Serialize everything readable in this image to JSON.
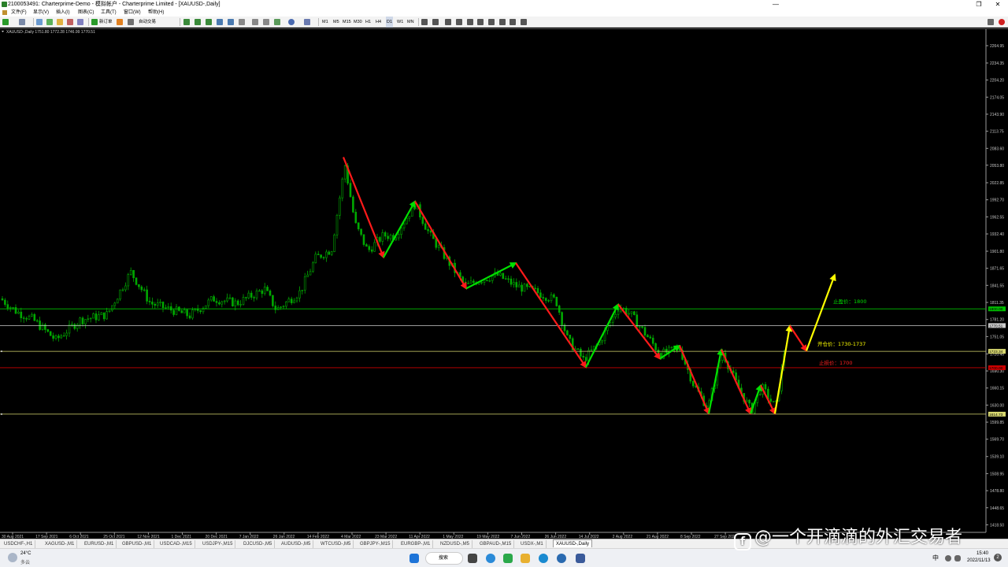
{
  "window": {
    "title": "2100053491: Charterprime-Demo - 模拟帐户 - Charterprime Limited - [XAUUSD-,Daily]",
    "controls": {
      "minimize": "—",
      "restore": "❐",
      "close": "✕"
    }
  },
  "menu": [
    "文件(F)",
    "显示(V)",
    "插入(I)",
    "图表(C)",
    "工具(T)",
    "窗口(W)",
    "帮助(H)"
  ],
  "toolbar": {
    "new_order": "新订单",
    "auto_trading": "自动交易",
    "timeframes": [
      "M1",
      "M5",
      "M15",
      "M30",
      "H1",
      "H4",
      "D1",
      "W1",
      "MN"
    ]
  },
  "chart": {
    "info": "XAUUSD-,Daily  1751.80 1772.28 1746.99 1770.51",
    "price_ticks": [
      "2264.95",
      "2234.35",
      "2204.20",
      "2174.05",
      "2143.90",
      "2113.75",
      "2083.60",
      "2053.80",
      "2022.85",
      "1992.70",
      "1962.55",
      "1932.40",
      "1901.80",
      "1871.65",
      "1841.55",
      "1811.35",
      "1781.20",
      "1751.05",
      "1720.45",
      "1690.30",
      "1660.15",
      "1630.00",
      "1599.85",
      "1569.70",
      "1539.10",
      "1508.95",
      "1478.80",
      "1448.65",
      "1418.50"
    ],
    "date_ticks": [
      "30 Aug 2021",
      "17 Sep 2021",
      "6 Oct 2021",
      "25 Oct 2021",
      "12 Nov 2021",
      "1 Dec 2021",
      "20 Dec 2021",
      "7 Jan 2022",
      "26 Jan 2022",
      "14 Feb 2022",
      "4 Mar 2022",
      "23 Mar 2022",
      "11 Apr 2022",
      "1 May 2022",
      "19 May 2022",
      "7 Jun 2022",
      "26 Jun 2022",
      "14 Jul 2022",
      "2 Aug 2022",
      "21 Aug 2022",
      "8 Sep 2022",
      "27 Sep 2022"
    ],
    "h_lines": [
      {
        "price": 1800,
        "color": "#00c000",
        "tag": "1800.00"
      },
      {
        "price": 1770.51,
        "color": "#cccccc",
        "tag": "1770.51"
      },
      {
        "price": 1725,
        "color": "#d8d870",
        "tag": "1723.34"
      },
      {
        "price": 1696,
        "color": "#cc0000",
        "tag": "1700.00"
      },
      {
        "price": 1614,
        "color": "#d8d870",
        "tag": "1614.73"
      }
    ],
    "annotations": {
      "take_profit": "止盈价：1800",
      "open_price": "开仓价：1730-1737",
      "stop_loss": "止损价：1700"
    },
    "colors": {
      "up": "#00e000",
      "down": "#ff1a1a",
      "projection": "#ffff00",
      "candle": "#00a800"
    }
  },
  "tabs": [
    "USDCHF-,H1",
    "XAGUSD-,M1",
    "EURUSD-,M1",
    "GBPUSD-,M1",
    "USDCAD-,M15",
    "USDJPY-,M15",
    "DJCUSD-,M5",
    "AUDUSD-,M5",
    "WTCUSD-,M5",
    "GBPJPY-,M15",
    "EURGBP-,M1",
    "NZDUSD-,M5",
    "GBPAUD-,M15",
    "USDX-,M1",
    "XAUUSD-,Daily"
  ],
  "active_tab": "XAUUSD-,Daily",
  "taskbar": {
    "weather_temp": "24°C",
    "weather_desc": "多云",
    "search": "搜索",
    "ime": "中",
    "time": "15:40",
    "date": "2022/11/13"
  },
  "watermark": "@一个开滴滴的外汇交易者"
}
